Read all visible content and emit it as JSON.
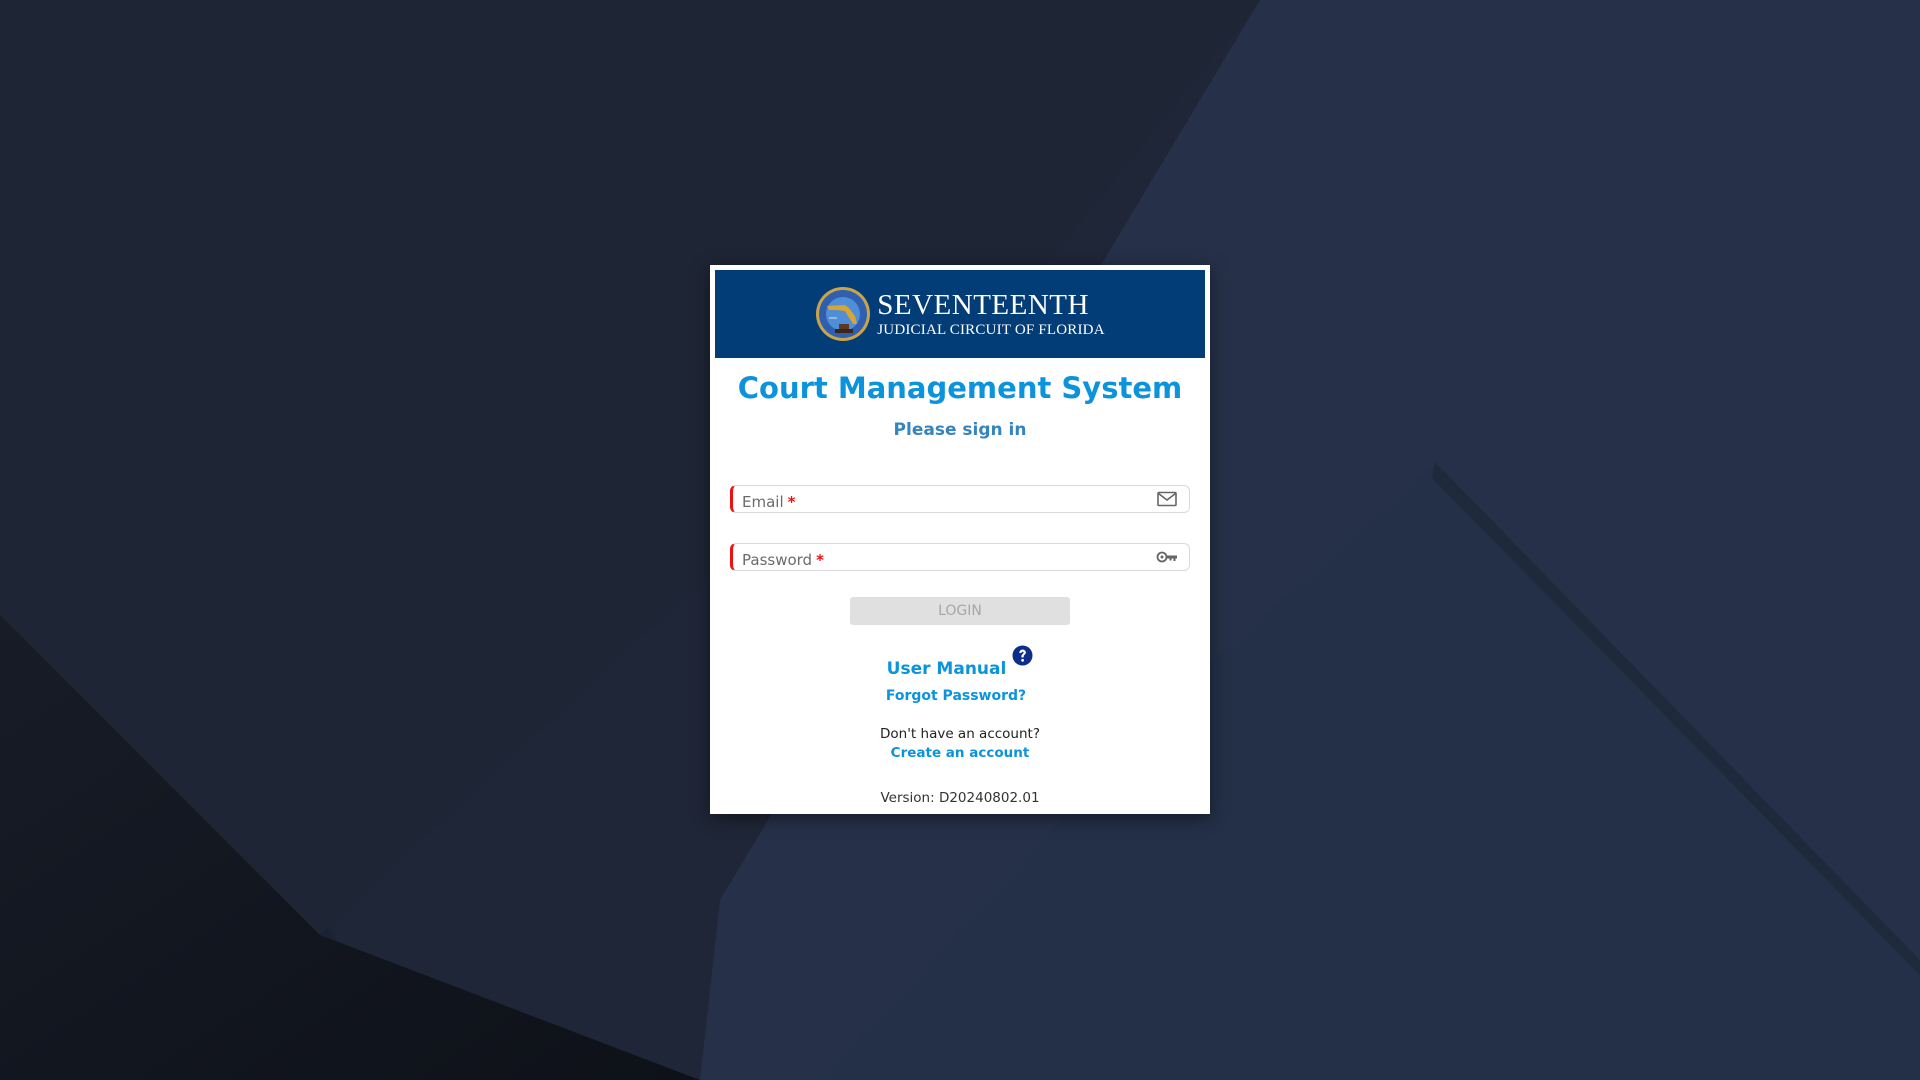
{
  "background": {
    "base_color": "#232c3f",
    "shadow_color": "#0f131b",
    "panel_color": "#273250"
  },
  "header": {
    "brand_line1": "SEVENTEENTH",
    "brand_line2": "JUDICIAL CIRCUIT OF FLORIDA",
    "banner_color": "#033d77",
    "seal_icon": "court-seal-icon"
  },
  "title": "Court Management System",
  "subtitle": "Please sign in",
  "form": {
    "email": {
      "label": "Email",
      "required_marker": "*",
      "value": "",
      "icon": "envelope-icon"
    },
    "password": {
      "label": "Password",
      "required_marker": "*",
      "value": "",
      "icon": "key-icon"
    },
    "login_label": "LOGIN"
  },
  "links": {
    "user_manual": "User Manual",
    "help_icon": "question-circle-icon",
    "forgot_password": "Forgot Password?",
    "no_account_text": "Don't have an account?",
    "create_account": "Create an account"
  },
  "version": "Version: D20240802.01",
  "colors": {
    "accent": "#0b93db",
    "subtitle": "#3584bd",
    "required": "#ee1111",
    "help_icon": "#0d2f8a",
    "button_disabled_bg": "#e0e0e0",
    "button_disabled_text": "#a6a6a6"
  }
}
